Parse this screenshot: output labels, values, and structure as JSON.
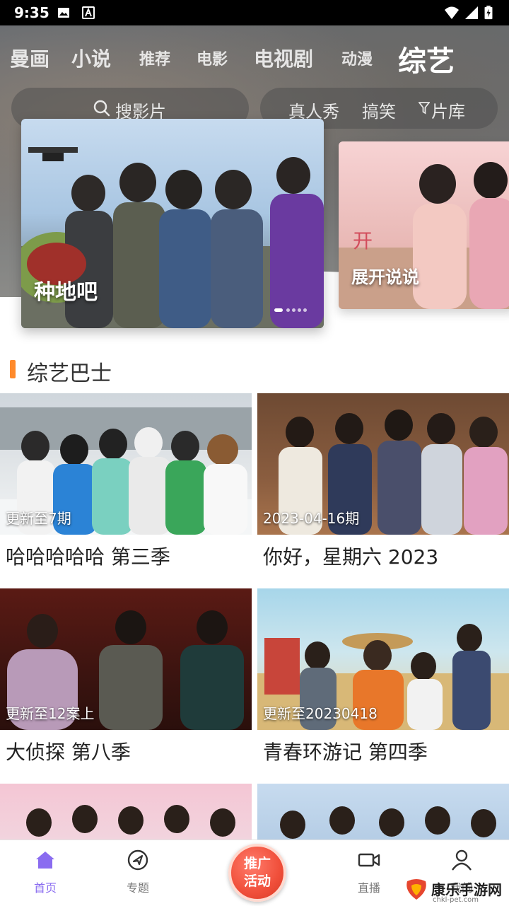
{
  "status_bar": {
    "time": "9:35"
  },
  "tabs": [
    {
      "label": "曼画"
    },
    {
      "label": "小说"
    },
    {
      "label": "推荐"
    },
    {
      "label": "电影"
    },
    {
      "label": "电视剧"
    },
    {
      "label": "动漫"
    },
    {
      "label": "综艺",
      "active": true
    }
  ],
  "search": {
    "placeholder": "搜影片"
  },
  "quick_links": [
    {
      "label": "真人秀"
    },
    {
      "label": "搞笑"
    },
    {
      "label": "片库"
    }
  ],
  "banner": {
    "main_title": "种地吧",
    "side_title": "展开说说",
    "dots": 5,
    "active_dot": 0
  },
  "section": {
    "title": "综艺巴士"
  },
  "cards": [
    {
      "title": "哈哈哈哈哈 第三季",
      "badge": "更新至7期"
    },
    {
      "title": "你好，星期六 2023",
      "badge": "2023-04-16期"
    },
    {
      "title": "大侦探 第八季",
      "badge": "更新至12案上"
    },
    {
      "title": "青春环游记 第四季",
      "badge": "更新至20230418"
    }
  ],
  "bottom_nav": {
    "items": [
      {
        "label": "首页",
        "icon": "home-icon",
        "active": true
      },
      {
        "label": "专题",
        "icon": "compass-icon"
      },
      {
        "label": "直播",
        "icon": "video-camera-icon"
      },
      {
        "label": "我的",
        "icon": "user-icon"
      }
    ],
    "promo": {
      "line1": "推广",
      "line2": "活动"
    }
  },
  "watermark": {
    "text": "康乐手游网",
    "sub": "chkl-pet.com"
  },
  "colors": {
    "accent": "#8a6cf0",
    "section_bar": "#ff8a2b",
    "promo": "#f04f3a"
  }
}
